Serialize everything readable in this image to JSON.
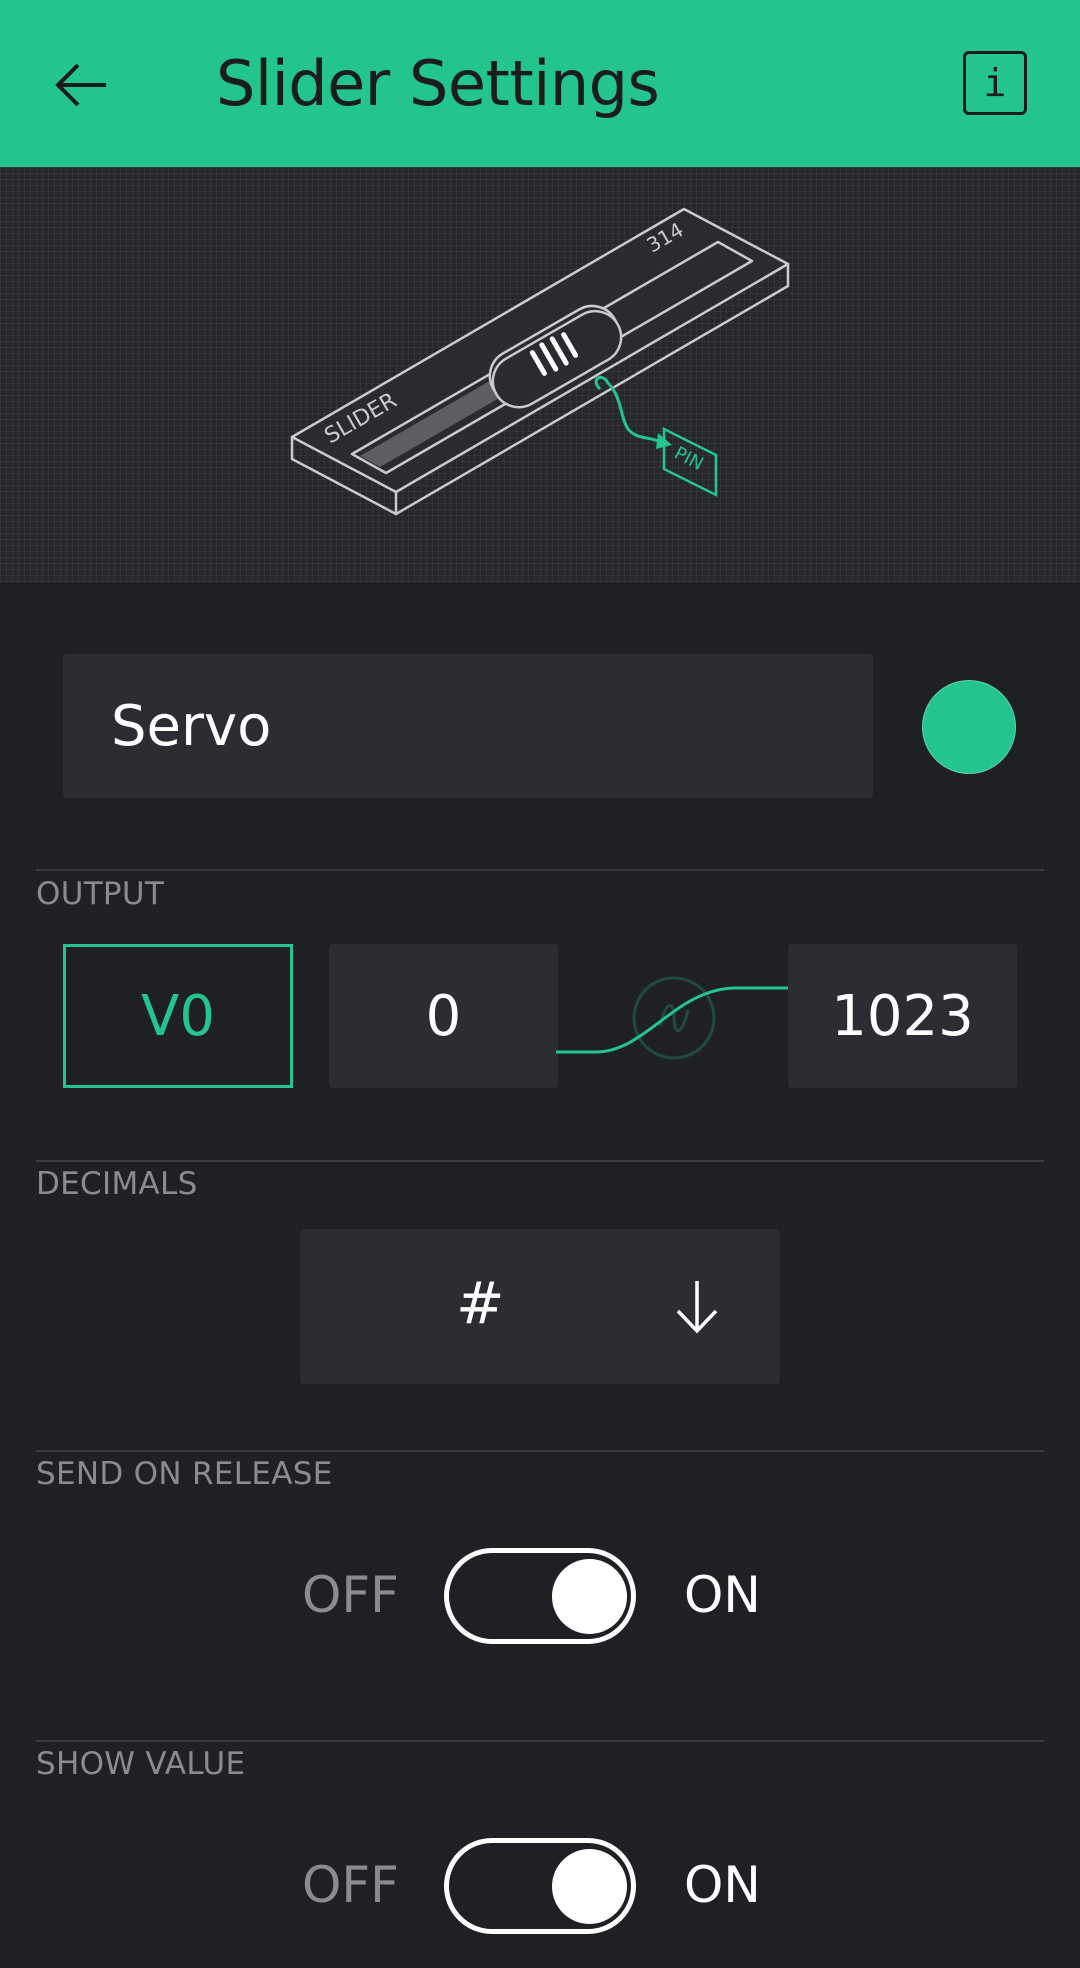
{
  "header": {
    "title": "Slider Settings"
  },
  "preview": {
    "slider_label": "SLIDER",
    "value_label": "314",
    "pin_label": "PIN"
  },
  "name_field": {
    "value": "Servo"
  },
  "accent_color": "#23c48e",
  "output": {
    "label": "OUTPUT",
    "pin": "V0",
    "min": "0",
    "max": "1023"
  },
  "decimals": {
    "label": "DECIMALS",
    "value": "#"
  },
  "send_on_release": {
    "label": "SEND ON RELEASE",
    "off_label": "OFF",
    "on_label": "ON",
    "state": "on"
  },
  "show_value": {
    "label": "SHOW VALUE",
    "off_label": "OFF",
    "on_label": "ON",
    "state": "on"
  }
}
